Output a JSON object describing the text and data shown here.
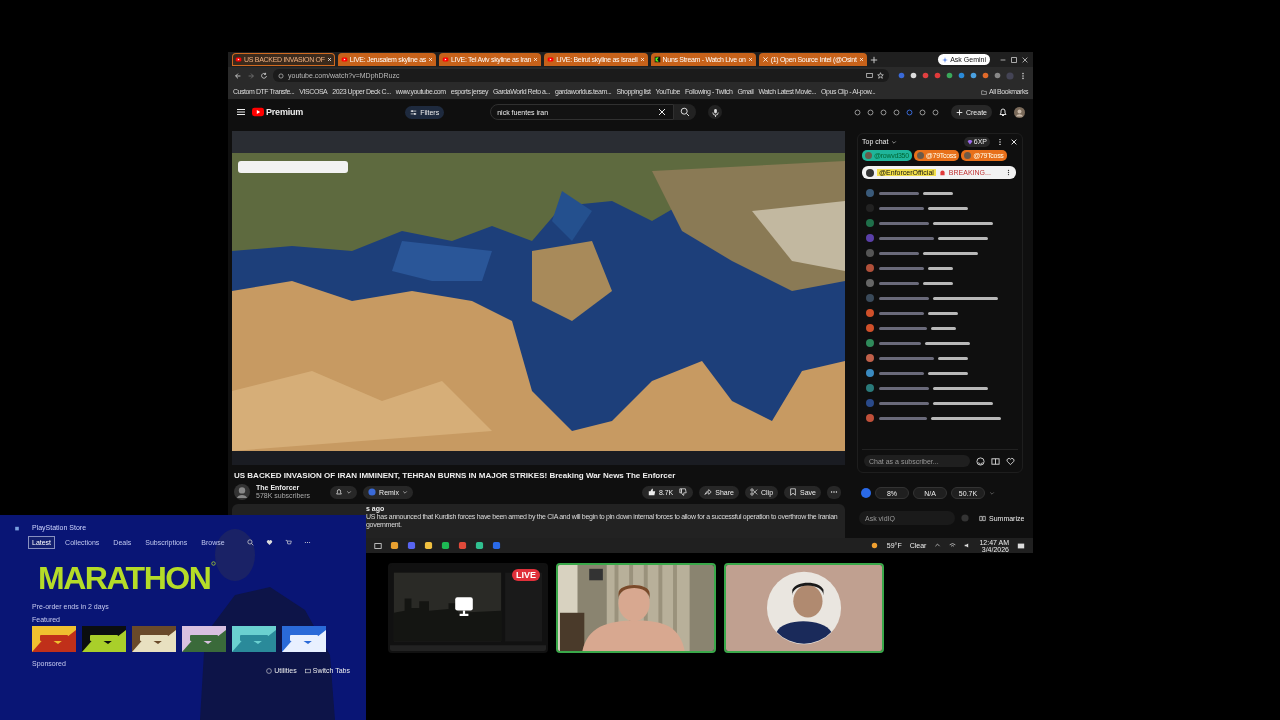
{
  "browser": {
    "tabs": [
      {
        "label": "US BACKED INVASION OF",
        "kind": "youtube",
        "selected": true
      },
      {
        "label": "LIVE: Jerusalem skyline as",
        "kind": "youtube",
        "selected": false
      },
      {
        "label": "LIVE: Tel Aviv skyline as Iran",
        "kind": "youtube",
        "selected": false
      },
      {
        "label": "LIVE: Beirut skyline as Israeli",
        "kind": "youtube",
        "selected": false
      },
      {
        "label": "Nuns Stream - Watch Live on",
        "kind": "kick",
        "selected": false
      },
      {
        "label": "(1) Open Source Intel (@Osint",
        "kind": "x",
        "selected": false
      }
    ],
    "ask_button": "Ask Gemini",
    "url": "youtube.com/watch?v=MDphDRuzc",
    "bookmarks": [
      "Custom DTF Transfe...",
      "VISCOSA",
      "2023 Upper Deck C...",
      "www.youtube.com",
      "esports jersey",
      "GardaWorld Reto a...",
      "gardaworldus.team...",
      "Shopping list",
      "YouTube",
      "Following - Twitch",
      "Gmail",
      "Watch Latest Movie...",
      "Opus Clip - AI-pow..."
    ],
    "all_bookmarks": "All Bookmarks"
  },
  "youtube": {
    "logo": "Premium",
    "filters": "Filters",
    "search": "nick fuentes iran",
    "create": "Create",
    "video_title": "US BACKED INVASION OF IRAN IMMINENT, TEHRAN BURNS IN MAJOR STRIKES! Breaking War News The Enforcer",
    "channel": "The Enforcer",
    "subscribers": "578K subscribers",
    "remix": "Remix",
    "likes": "8.7K",
    "share": "Share",
    "clip": "Clip",
    "save": "Save",
    "description_time": "s ago",
    "description": "US has announced that Kurdish forces have been armed by the CIA and will begin to pin down internal forces to allow for a successful operation to overthrow the Iranian government.",
    "chat": {
      "mode": "Top chat",
      "points": "6XP",
      "donors": [
        "@rowvd350",
        "@79Tcoss",
        "@79Tcoss"
      ],
      "pinned_author": "@EnforcerOfficial",
      "pinned_text": "BREAKING...",
      "messages": [
        {
          "color": "#3a5a7a"
        },
        {
          "color": "#222222"
        },
        {
          "color": "#1f6f4a"
        },
        {
          "color": "#5a3fa8"
        },
        {
          "color": "#555555"
        },
        {
          "color": "#b0503a"
        },
        {
          "color": "#666666"
        },
        {
          "color": "#3a4a5a"
        },
        {
          "color": "#d0502a"
        },
        {
          "color": "#d0502a"
        },
        {
          "color": "#2f8a5a"
        },
        {
          "color": "#c0604a"
        },
        {
          "color": "#3a8ac0"
        },
        {
          "color": "#2a7a7a"
        },
        {
          "color": "#2a4a8a"
        },
        {
          "color": "#c0503a"
        }
      ],
      "placeholder": "Chat as a subscriber..."
    },
    "stats": [
      "8%",
      "N/A",
      "50.7K"
    ],
    "ask_placeholder": "Ask vidIQ",
    "summarize": "Summarize"
  },
  "taskbar": {
    "temperature": "59°F",
    "weather": "Clear",
    "time": "12:47 AM",
    "date": "3/4/2026"
  },
  "ps_store": {
    "title": "PlayStation Store",
    "nav": [
      {
        "label": "Latest",
        "selected": true
      },
      {
        "label": "Collections",
        "selected": false
      },
      {
        "label": "Deals",
        "selected": false
      },
      {
        "label": "Subscriptions",
        "selected": false
      },
      {
        "label": "Browse",
        "selected": false
      }
    ],
    "logo": "MARATHON",
    "promo": "Pre-order ends in 2 days",
    "featured": "Featured",
    "sponsored": "Sponsored",
    "utilities": "Utilities",
    "switch_tabs": "Switch Tabs"
  },
  "cams": [
    {
      "kind": "screen",
      "live": "LIVE",
      "highlighted": false
    },
    {
      "kind": "webcam",
      "highlighted": true
    },
    {
      "kind": "avatar",
      "highlighted": true
    }
  ]
}
